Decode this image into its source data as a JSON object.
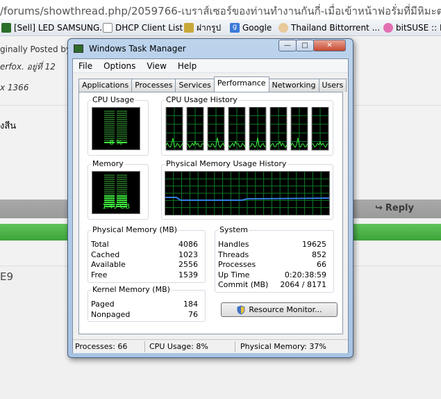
{
  "browser": {
    "url": "/forums/showthread.php/2059766-เบราส์เซอร์ของท่านทำงานกันกี่-เมื่อเข้าหน้าฟอรั่มที่มีหิมะตก",
    "bookmarks": [
      "[Sell] LED SAMSUNG...",
      "DHCP Client List",
      "ฝากรูป",
      "Google",
      "Thailand Bittorrent ...",
      "bitSUSE :: B"
    ],
    "quote_posted_by": "ginally Posted by",
    "quote_line1": "erfox. อยู่ที่ 12",
    "quote_line2": "x 1366",
    "body_text": "งสีน",
    "reply_label": "Reply",
    "lower_text": "E9"
  },
  "window": {
    "title": "Windows Task Manager",
    "buttons": {
      "minimize": "—",
      "maximize": "□",
      "close": "✕"
    },
    "menu": [
      "File",
      "Options",
      "View",
      "Help"
    ],
    "tabs": [
      "Applications",
      "Processes",
      "Services",
      "Performance",
      "Networking",
      "Users"
    ],
    "active_tab": "Performance"
  },
  "performance": {
    "cpu_usage_label": "CPU Usage",
    "cpu_usage_value": "8 %",
    "cpu_usage_fraction": 0.08,
    "cpu_history_label": "CPU Usage History",
    "cpu_core_count": 8,
    "memory_label": "Memory",
    "memory_value": "1.49 GB",
    "memory_fraction": 0.37,
    "memory_history_label": "Physical Memory Usage History"
  },
  "physical_memory": {
    "title": "Physical Memory (MB)",
    "rows": [
      {
        "key": "Total",
        "value": "4086"
      },
      {
        "key": "Cached",
        "value": "1023"
      },
      {
        "key": "Available",
        "value": "2556"
      },
      {
        "key": "Free",
        "value": "1539"
      }
    ]
  },
  "kernel_memory": {
    "title": "Kernel Memory (MB)",
    "rows": [
      {
        "key": "Paged",
        "value": "184"
      },
      {
        "key": "Nonpaged",
        "value": "76"
      }
    ]
  },
  "system": {
    "title": "System",
    "rows": [
      {
        "key": "Handles",
        "value": "19625"
      },
      {
        "key": "Threads",
        "value": "852"
      },
      {
        "key": "Processes",
        "value": "66"
      },
      {
        "key": "Up Time",
        "value": "0:20:38:59"
      },
      {
        "key": "Commit (MB)",
        "value": "2064 / 8171"
      }
    ]
  },
  "resource_monitor_label": "Resource Monitor...",
  "status": {
    "processes": "Processes: 66",
    "cpu": "CPU Usage: 8%",
    "memory": "Physical Memory: 37%"
  },
  "colors": {
    "meter_green": "#3ef03e",
    "grid_green": "#0f7a2a",
    "memory_line": "#2f7fe0"
  },
  "icons": [
    "shield-icon",
    "reply-icon",
    "app-icon"
  ]
}
